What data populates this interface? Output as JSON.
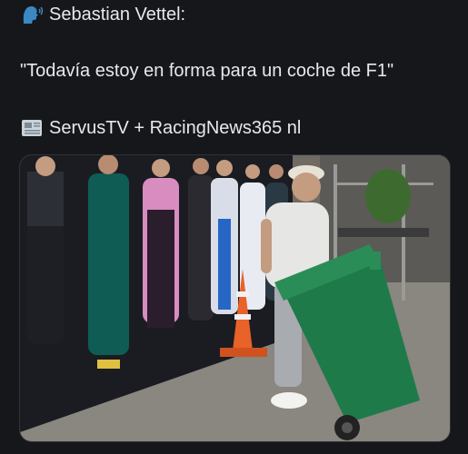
{
  "post": {
    "author_line": "Sebastian Vettel:",
    "quote": "\"Todavía estoy en forma para un coche de F1\"",
    "source_line": "ServusTV + RacingNews365 nl",
    "icons": {
      "speaker": "speaking-head-icon",
      "source": "newspaper-icon"
    }
  },
  "photo": {
    "description_colors": {
      "trash_bin": "#1f7a4a",
      "cone": "#e8622a",
      "banner": "#1a1c22"
    }
  }
}
